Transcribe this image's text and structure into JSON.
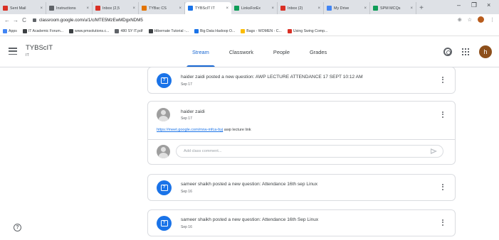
{
  "browser": {
    "tabs": [
      {
        "label": "Sent Mail",
        "fav_color": "#d93025"
      },
      {
        "label": "Instructions",
        "fav_color": "#5f6368"
      },
      {
        "label": "Inbox (2,5",
        "fav_color": "#d93025"
      },
      {
        "label": "TYBsc CS",
        "fav_color": "#e37400"
      },
      {
        "label": "TYBScIT IT",
        "fav_color": "#1a73e8"
      },
      {
        "label": "LinksForEx",
        "fav_color": "#0f9d58"
      },
      {
        "label": "Inbox (2)",
        "fav_color": "#d93025"
      },
      {
        "label": "My Drive",
        "fav_color": "#4285f4"
      },
      {
        "label": "SPM MCQs",
        "fav_color": "#0f9d58"
      }
    ],
    "active_tab_index": 4,
    "new_tab": "+",
    "minimize": "–",
    "maximize": "❐",
    "close": "×",
    "back": "←",
    "forward": "→",
    "reload": "C",
    "url": "classroom.google.com/u/1/c/MTE5MzEwMDgxNDM5",
    "bookmarks": [
      {
        "label": "Apps",
        "color": "#4285f4"
      },
      {
        "label": "IT Academic Forum...",
        "color": "#3c4043"
      },
      {
        "label": "www.pmsolutions.c...",
        "color": "#3c4043"
      },
      {
        "label": "480 SY IT.pdf",
        "color": "#5f6368"
      },
      {
        "label": "Hibernate Tutorial -...",
        "color": "#3c4043"
      },
      {
        "label": "Big Data Hadoop O...",
        "color": "#1a73e8"
      },
      {
        "label": "Bags - WOMEN - C...",
        "color": "#fbbc04"
      },
      {
        "label": "Using Swing Comp...",
        "color": "#d93025"
      }
    ]
  },
  "classroom": {
    "class_name": "TYBScIT",
    "section": "IT",
    "tabs": [
      "Stream",
      "Classwork",
      "People",
      "Grades"
    ],
    "active_tab": "Stream",
    "user_initial": "h",
    "help_glyph": "?"
  },
  "stream": {
    "cards": [
      {
        "type": "question",
        "title": "haider zaidi posted a new question: AWP LECTURE ATTENDANCE 17 SEPT 10:12 AM",
        "date": "Sep 17"
      },
      {
        "type": "post",
        "author": "haider zaidi",
        "date": "Sep 17",
        "link": "https://meet.google.com/mrw-mfca-byj",
        "link_text": "awp lecture link",
        "comment_placeholder": "Add class comment..."
      },
      {
        "type": "question",
        "title": "sameer shaikh posted a new question: Attendance 16th sep Linux",
        "date": "Sep 16"
      },
      {
        "type": "question",
        "title": "sameer shaikh posted a new question: Attendance 16th Sep Linux",
        "date": "Sep 16"
      }
    ]
  }
}
